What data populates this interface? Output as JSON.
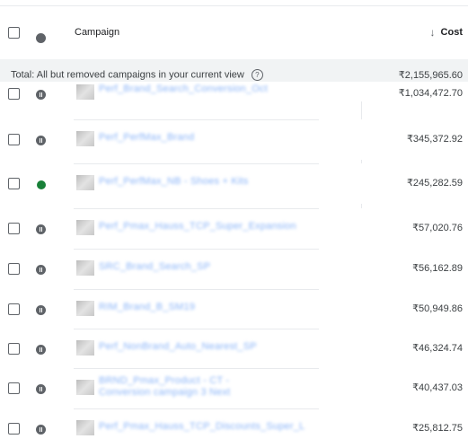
{
  "header": {
    "campaign_label": "Campaign",
    "cost_label": "Cost",
    "sort_icon": "arrow-down-icon"
  },
  "total": {
    "label": "Total: All but removed campaigns in your current view",
    "help_icon": "help-circle-icon",
    "value": "₹2,155,965.60"
  },
  "colors": {
    "link": "#8ab4f8",
    "enabled": "#188038",
    "paused": "#5f6368",
    "total_bg": "#f1f3f4"
  },
  "rows": [
    {
      "status": "paused",
      "name": "Perf_Brand_Search_Conversion_Oct",
      "cost": "₹1,034,472.70"
    },
    {
      "status": "paused",
      "name": "Perf_PerfMax_Brand",
      "cost": "₹345,372.92"
    },
    {
      "status": "enabled",
      "name": "Perf_PerfMax_NB - Shoes + Kits",
      "cost": "₹245,282.59"
    },
    {
      "status": "paused",
      "name": "Perf_Pmax_Hauss_TCP_Super_Expansion",
      "cost": "₹57,020.76"
    },
    {
      "status": "paused",
      "name": "SRC_Brand_Search_SP",
      "cost": "₹56,162.89"
    },
    {
      "status": "paused",
      "name": "RIM_Brand_B_SM19",
      "cost": "₹50,949.86"
    },
    {
      "status": "paused",
      "name": "Perf_NonBrand_Auto_Nearest_SP",
      "cost": "₹46,324.74"
    },
    {
      "status": "paused",
      "name": "BRND_Pmax_Product - CT - Conversion campaign 3 Next",
      "cost": "₹40,437.03"
    },
    {
      "status": "paused",
      "name": "Perf_Pmax_Hauss_TCP_Discounts_Super_L",
      "cost": "₹25,812.75"
    }
  ]
}
